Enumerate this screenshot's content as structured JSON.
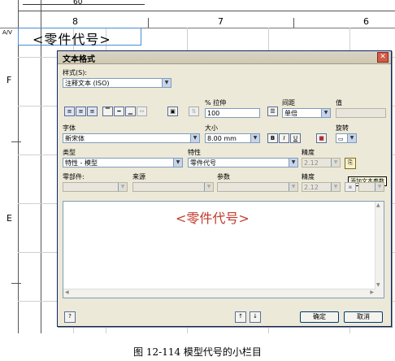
{
  "drawing": {
    "ruler_top_value": "60",
    "column_numbers": [
      "8",
      "7",
      "6"
    ],
    "row_letters": [
      "F",
      "E"
    ],
    "left_marker": "A/V",
    "text_box": "<零件代号>"
  },
  "dialog": {
    "title": "文本格式",
    "style_label": "样式(S):",
    "style_value": "注释文本 (ISO)",
    "stretch_label": "% 拉伸",
    "stretch_value": "100",
    "spacing_label": "间距",
    "spacing_value": "单倍",
    "value_label": "值",
    "font_label": "字体",
    "font_value": "新宋体",
    "size_label": "大小",
    "size_value": "8.00 mm",
    "bold": "B",
    "italic": "I",
    "underline": "U",
    "rotation_label": "旋转",
    "type_label": "类型",
    "type_value": "特性 - 模型",
    "property_label": "特性",
    "property_value": "零件代号",
    "precision_label": "精度",
    "precision_value": "2.12",
    "part_label": "零部件:",
    "source_label": "来源",
    "param_label": "参数",
    "precision2_label": "精度",
    "precision2_value": "2.12",
    "tooltip": "添加文本参数",
    "content_text": "<零件代号>",
    "ok_label": "确定",
    "cancel_label": "取消"
  },
  "caption": "图 12-114  模型代号的小栏目"
}
